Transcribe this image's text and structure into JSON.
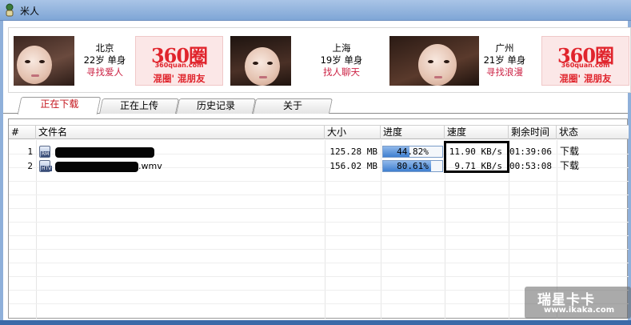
{
  "window": {
    "title": "米人"
  },
  "banner": {
    "profiles": [
      {
        "city": "北京",
        "age_status": "22岁 单身",
        "link": "寻找爱人"
      },
      {
        "city": "上海",
        "age_status": "19岁 单身",
        "link": "找人聊天"
      },
      {
        "city": "广州",
        "age_status": "21岁 单身",
        "link": "寻找浪漫"
      }
    ],
    "ads": [
      {
        "logo": "360圈",
        "domain": "360quan.com",
        "slogan": "混圈' 混朋友"
      },
      {
        "logo": "360圈",
        "domain": "360quan.com",
        "slogan": "混圈' 混朋友"
      }
    ]
  },
  "tabs": [
    "正在下载",
    "正在上传",
    "历史记录",
    "关于"
  ],
  "active_tab": "正在下载",
  "table": {
    "columns": [
      "#",
      "文件名",
      "大小",
      "进度",
      "速度",
      "剩余时间",
      "状态"
    ],
    "rows": [
      {
        "num": "1",
        "icon": "rm-file-icon",
        "icon_text": "RM",
        "name_suffix": "",
        "size": "125.28 MB",
        "progress": 0.4482,
        "progress_text": "44.82%",
        "speed": "11.90 KB/s",
        "remaining": "01:39:06",
        "status": "下载"
      },
      {
        "num": "2",
        "icon": "wmv-file-icon",
        "icon_text": "HTV",
        "name_suffix": ".wmv",
        "size": "156.02 MB",
        "progress": 0.8061,
        "progress_text": "80.61%",
        "speed": "9.71 KB/s",
        "remaining": "00:53:08",
        "status": "下载"
      }
    ]
  },
  "watermark": {
    "title": "瑞星卡卡",
    "url": "www.ikaka.com"
  },
  "colors": {
    "active_tab_text": "#c4141c",
    "ad_red": "#e0242c",
    "profile_link": "#cc2244",
    "progress_fill": "#3f7fd0"
  }
}
